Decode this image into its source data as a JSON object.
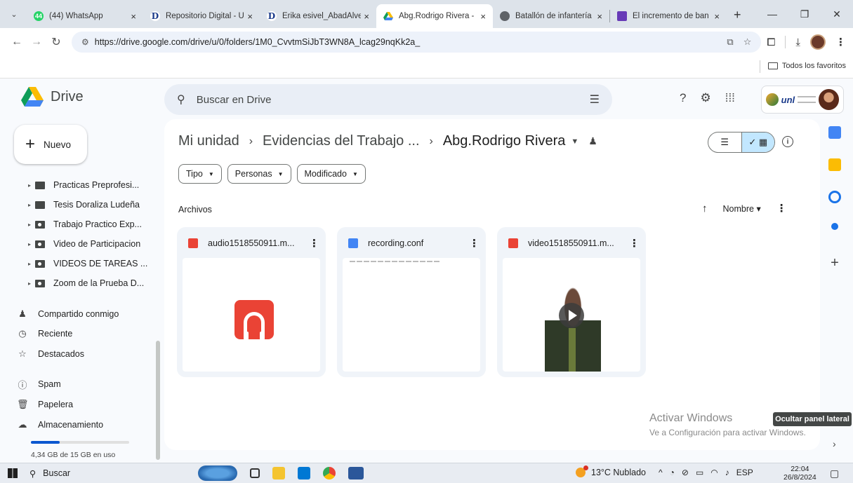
{
  "browser": {
    "tabs": [
      {
        "title": "(44) WhatsApp",
        "favicon_color": "#25d366",
        "favicon_text": "44"
      },
      {
        "title": "Repositorio Digital - U",
        "favicon_color": "#1a3a8a",
        "favicon_text": "D"
      },
      {
        "title": "Erika esivel_AbadAlve",
        "favicon_color": "#1a3a8a",
        "favicon_text": "D"
      },
      {
        "title": "Abg.Rodrigo Rivera -",
        "favicon_color": "#fbbc04",
        "favicon_text": "",
        "active": true
      },
      {
        "title": "Batallón de infantería",
        "favicon_color": "#5f6368",
        "favicon_text": ""
      },
      {
        "title": "El incremento de ban",
        "favicon_color": "#673ab7",
        "favicon_text": ""
      }
    ],
    "url": "https://drive.google.com/drive/u/0/folders/1M0_CvvtmSiJbT3WN8A_lcag29nqKk2a_",
    "bookmarks_folder": "Todos los favoritos"
  },
  "drive": {
    "logo_text": "Drive",
    "search_placeholder": "Buscar en Drive",
    "new_label": "Nuevo",
    "tree": [
      {
        "label": "Practicas Preprofesi...",
        "shared": false
      },
      {
        "label": "Tesis Doraliza Ludeña",
        "shared": false
      },
      {
        "label": "Trabajo Practico Exp...",
        "shared": true
      },
      {
        "label": "Video de Participacion",
        "shared": true
      },
      {
        "label": "VIDEOS DE TAREAS ...",
        "shared": true
      },
      {
        "label": "Zoom de la Prueba D...",
        "shared": true
      }
    ],
    "nav": {
      "shared": "Compartido conmigo",
      "recent": "Reciente",
      "starred": "Destacados",
      "spam": "Spam",
      "trash": "Papelera",
      "storage": "Almacenamiento"
    },
    "storage_text": "4,34 GB de 15 GB en uso",
    "storage_fraction": 0.29,
    "breadcrumb": {
      "root": "Mi unidad",
      "parent": "Evidencias del Trabajo ...",
      "current": "Abg.Rodrigo Rivera"
    },
    "filters": {
      "type": "Tipo",
      "people": "Personas",
      "modified": "Modificado"
    },
    "section_label": "Archivos",
    "sort_label": "Nombre",
    "files": [
      {
        "name": "audio1518550911.m...",
        "kind": "audio",
        "icon_color": "#ea4335"
      },
      {
        "name": "recording.conf",
        "kind": "document",
        "icon_color": "#4285f4"
      },
      {
        "name": "video1518550911.m...",
        "kind": "video",
        "icon_color": "#ea4335"
      }
    ],
    "tooltip": "Ocultar panel lateral",
    "watermark": {
      "title": "Activar Windows",
      "subtitle": "Ve a Configuración para activar Windows."
    }
  },
  "taskbar": {
    "search": "Buscar",
    "weather": "13°C  Nublado",
    "lang": "ESP",
    "time": "22:04",
    "date": "26/8/2024"
  }
}
